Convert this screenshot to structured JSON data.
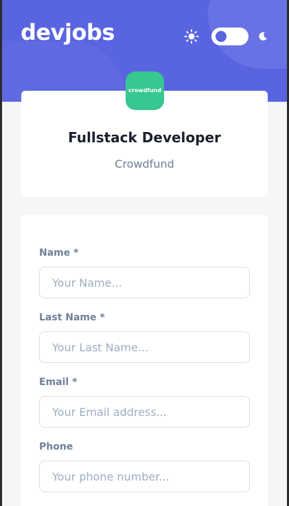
{
  "header": {
    "logo": "devjobs",
    "theme_icons": {
      "light": "sun-icon",
      "dark": "moon-icon"
    }
  },
  "company": {
    "logo_text": "crowdfund",
    "job_title": "Fullstack Developer",
    "name": "Crowdfund",
    "logo_color": "#37c790"
  },
  "form": {
    "fields": [
      {
        "label": "Name *",
        "placeholder": "Your Name..."
      },
      {
        "label": "Last Name *",
        "placeholder": "Your Last Name..."
      },
      {
        "label": "Email *",
        "placeholder": "Your Email address..."
      },
      {
        "label": "Phone",
        "placeholder": "Your phone number..."
      }
    ]
  },
  "colors": {
    "accent": "#5964e0",
    "background": "#f4f6f8",
    "label": "#6e8098"
  }
}
